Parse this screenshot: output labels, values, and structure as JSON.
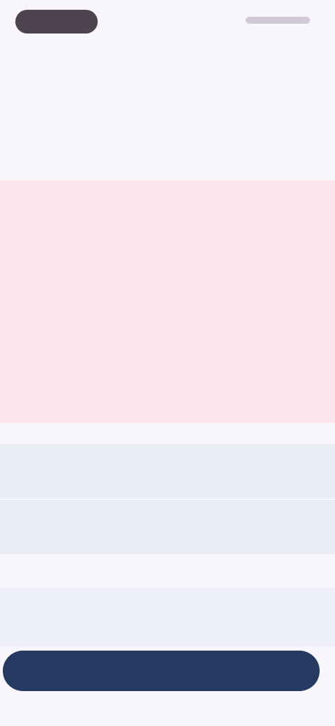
{
  "status_bar": {
    "left_pill": "",
    "right_icons": ""
  },
  "header": {
    "eyebrow": "",
    "title": "",
    "subtitle": ""
  },
  "warning_card": {
    "title": "",
    "body": "",
    "link": ""
  },
  "fields": [
    {
      "label": ""
    },
    {
      "label": ""
    }
  ],
  "options": {
    "label": "",
    "items": [
      {
        "icon": ""
      },
      {
        "icon": ""
      },
      {
        "icon": ""
      }
    ]
  },
  "primary_action": {
    "label": ""
  }
}
